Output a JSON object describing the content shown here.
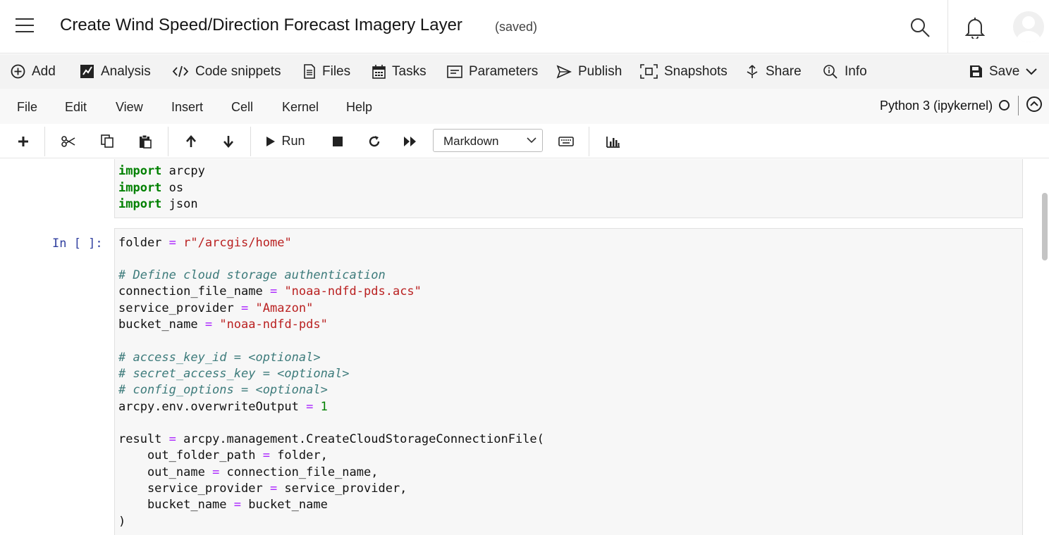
{
  "header": {
    "title": "Create Wind Speed/Direction Forecast Imagery Layer",
    "status": "(saved)",
    "icons": [
      "menu-icon",
      "search-icon",
      "bell-icon",
      "avatar"
    ]
  },
  "nb_toolbar": {
    "add": "Add",
    "analysis": "Analysis",
    "code_snippets": "Code snippets",
    "files": "Files",
    "tasks": "Tasks",
    "parameters": "Parameters",
    "publish": "Publish",
    "snapshots": "Snapshots",
    "share": "Share",
    "info": "Info",
    "save": "Save"
  },
  "menu": {
    "file": "File",
    "edit": "Edit",
    "view": "View",
    "insert": "Insert",
    "cell": "Cell",
    "kernel": "Kernel",
    "help": "Help"
  },
  "kernel": {
    "name": "Python 3 (ipykernel)"
  },
  "cell_toolbar": {
    "run": "Run",
    "cell_type": "Markdown"
  },
  "cells": [
    {
      "prompt": "",
      "lines": [
        [
          [
            "kw",
            "import"
          ],
          [
            "",
            " arcpy"
          ]
        ],
        [
          [
            "kw",
            "import"
          ],
          [
            "",
            " os"
          ]
        ],
        [
          [
            "kw",
            "import"
          ],
          [
            "",
            " json"
          ]
        ]
      ]
    },
    {
      "prompt": "In [ ]:",
      "lines": [
        [
          [
            "",
            "folder "
          ],
          [
            "op",
            "="
          ],
          [
            "",
            " "
          ],
          [
            "str",
            "r\"/arcgis/home\""
          ]
        ],
        [],
        [
          [
            "cm",
            "# Define cloud storage authentication"
          ]
        ],
        [
          [
            "",
            "connection_file_name "
          ],
          [
            "op",
            "="
          ],
          [
            "",
            " "
          ],
          [
            "str",
            "\"noaa-ndfd-pds.acs\""
          ]
        ],
        [
          [
            "",
            "service_provider "
          ],
          [
            "op",
            "="
          ],
          [
            "",
            " "
          ],
          [
            "str",
            "\"Amazon\""
          ]
        ],
        [
          [
            "",
            "bucket_name "
          ],
          [
            "op",
            "="
          ],
          [
            "",
            " "
          ],
          [
            "str",
            "\"noaa-ndfd-pds\""
          ]
        ],
        [],
        [
          [
            "cm",
            "# access_key_id = <optional>"
          ]
        ],
        [
          [
            "cm",
            "# secret_access_key = <optional>"
          ]
        ],
        [
          [
            "cm",
            "# config_options = <optional>"
          ]
        ],
        [
          [
            "",
            "arcpy.env.overwriteOutput "
          ],
          [
            "op",
            "="
          ],
          [
            "",
            " "
          ],
          [
            "num",
            "1"
          ]
        ],
        [],
        [
          [
            "",
            "result "
          ],
          [
            "op",
            "="
          ],
          [
            "",
            " arcpy.management.CreateCloudStorageConnectionFile("
          ]
        ],
        [
          [
            "",
            "    out_folder_path "
          ],
          [
            "op",
            "="
          ],
          [
            "",
            " folder,"
          ]
        ],
        [
          [
            "",
            "    out_name "
          ],
          [
            "op",
            "="
          ],
          [
            "",
            " connection_file_name,"
          ]
        ],
        [
          [
            "",
            "    service_provider "
          ],
          [
            "op",
            "="
          ],
          [
            "",
            " service_provider,"
          ]
        ],
        [
          [
            "",
            "    bucket_name "
          ],
          [
            "op",
            "="
          ],
          [
            "",
            " bucket_name"
          ]
        ],
        [
          [
            "",
            ")"
          ]
        ]
      ]
    }
  ]
}
